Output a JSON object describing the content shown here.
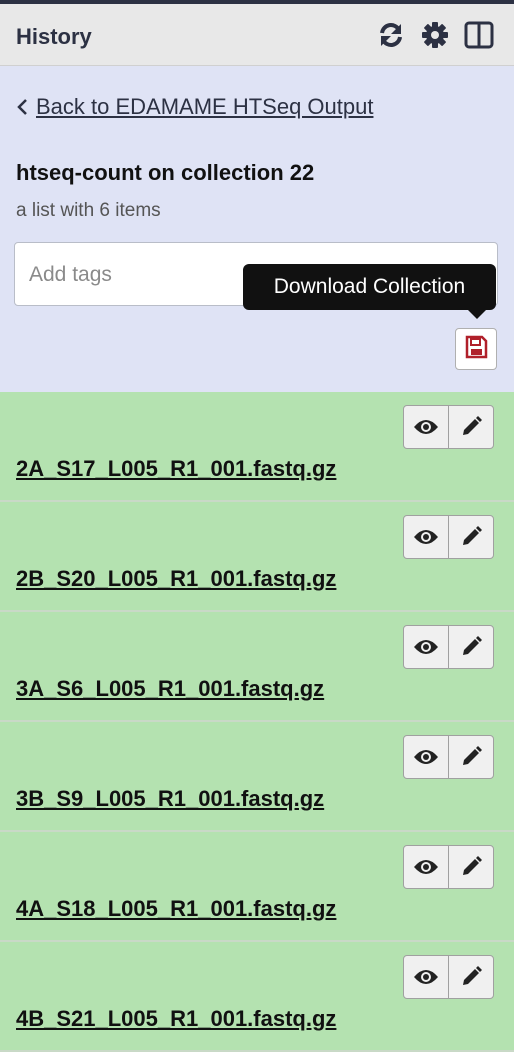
{
  "header": {
    "title": "History",
    "icons": [
      "refresh-icon",
      "gear-icon",
      "columns-icon"
    ]
  },
  "collection": {
    "back_label": "Back to EDAMAME HTSeq Output",
    "name": "htseq-count on collection 22",
    "description": "a list with 6 items",
    "tags_placeholder": "Add tags",
    "download_tooltip": "Download Collection"
  },
  "items": [
    {
      "name": "2A_S17_L005_R1_001.fastq.gz"
    },
    {
      "name": "2B_S20_L005_R1_001.fastq.gz"
    },
    {
      "name": "3A_S6_L005_R1_001.fastq.gz"
    },
    {
      "name": "3B_S9_L005_R1_001.fastq.gz"
    },
    {
      "name": "4A_S18_L005_R1_001.fastq.gz"
    },
    {
      "name": "4B_S21_L005_R1_001.fastq.gz"
    }
  ],
  "colors": {
    "header_bg": "#e8e8e8",
    "panel_bg": "#dfe3f5",
    "item_bg": "#b4e2b0",
    "download_icon": "#b0202a"
  }
}
